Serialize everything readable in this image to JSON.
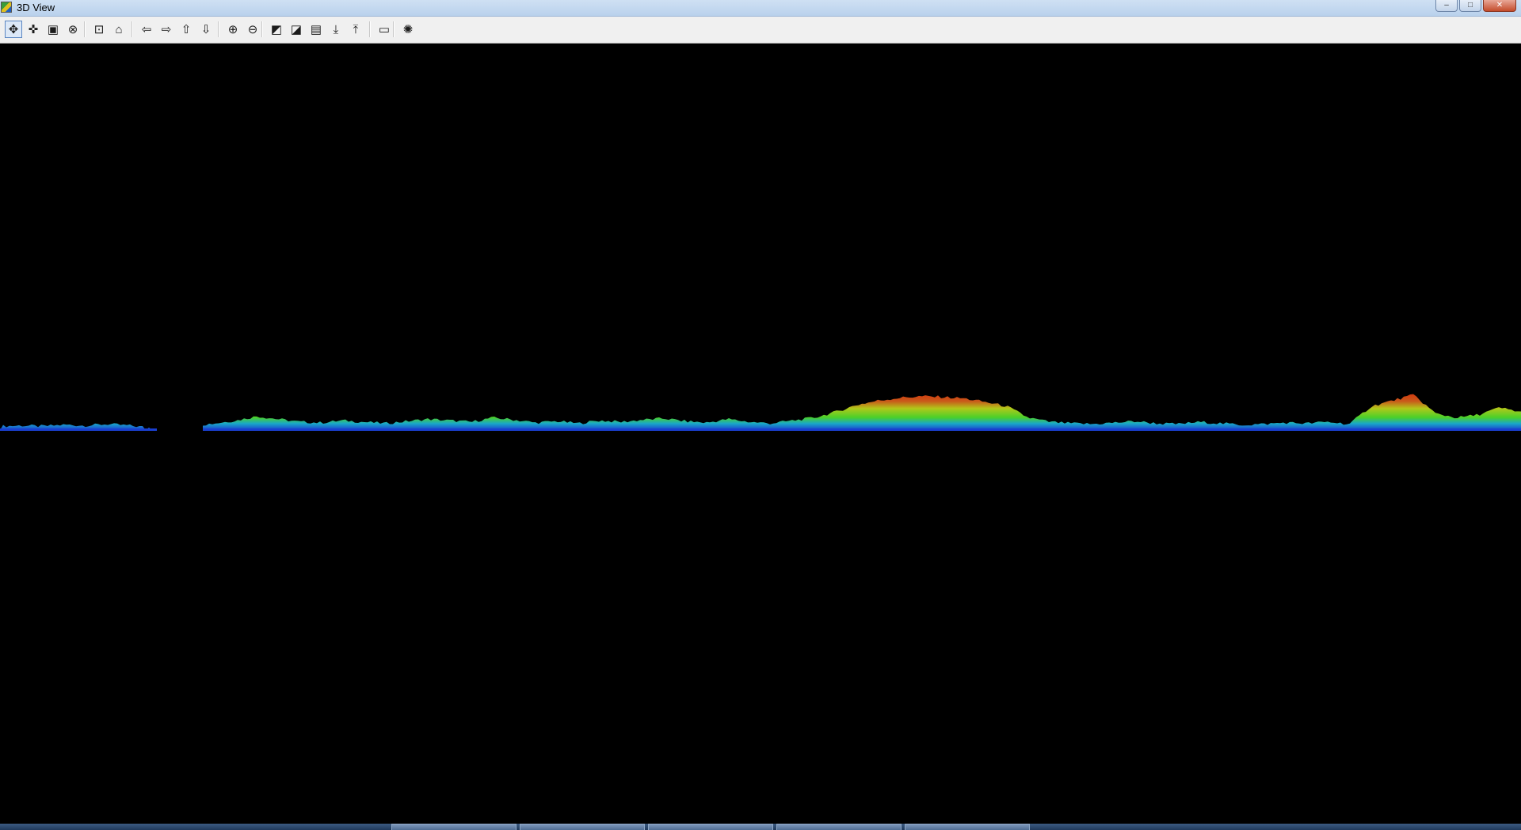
{
  "window": {
    "title": "3D View",
    "controls": {
      "minimize": "–",
      "maximize": "□",
      "close": "✕"
    }
  },
  "toolbar": {
    "buttons": [
      {
        "id": "rotate",
        "icon": "rotate-arrows-icon",
        "glyph": "✥",
        "active": true
      },
      {
        "id": "pan",
        "icon": "pan-arrows-icon",
        "glyph": "✜",
        "active": false
      },
      {
        "id": "zoom-window",
        "icon": "zoom-window-icon",
        "glyph": "▣",
        "active": false
      },
      {
        "id": "find",
        "icon": "binoculars-icon",
        "glyph": "⊗",
        "active": false
      },
      {
        "id": "fit-all",
        "icon": "fit-view-icon",
        "glyph": "⊡",
        "active": false
      },
      {
        "id": "home",
        "icon": "home-icon",
        "glyph": "⌂",
        "active": false
      },
      {
        "id": "left",
        "icon": "arrow-left-icon",
        "glyph": "⇦",
        "active": false
      },
      {
        "id": "right",
        "icon": "arrow-right-icon",
        "glyph": "⇨",
        "active": false
      },
      {
        "id": "up",
        "icon": "arrow-up-icon",
        "glyph": "⇧",
        "active": false
      },
      {
        "id": "down",
        "icon": "arrow-down-icon",
        "glyph": "⇩",
        "active": false
      },
      {
        "id": "zoom-in",
        "icon": "zoom-in-icon",
        "glyph": "⊕",
        "active": false
      },
      {
        "id": "zoom-out",
        "icon": "zoom-out-icon",
        "glyph": "⊖",
        "active": false
      },
      {
        "id": "surface",
        "icon": "surface-chart-icon",
        "glyph": "◩",
        "active": false
      },
      {
        "id": "surface-edit",
        "icon": "surface-edit-icon",
        "glyph": "◪",
        "active": false
      },
      {
        "id": "layers",
        "icon": "layers-icon",
        "glyph": "▤",
        "active": false
      },
      {
        "id": "import",
        "icon": "import-down-icon",
        "glyph": "⤓",
        "active": false
      },
      {
        "id": "export",
        "icon": "export-up-icon",
        "glyph": "⤒",
        "active": false
      },
      {
        "id": "save",
        "icon": "floppy-disk-icon",
        "glyph": "▭",
        "active": false
      },
      {
        "id": "settings",
        "icon": "light-settings-icon",
        "glyph": "✺",
        "active": false
      }
    ]
  },
  "colors": {
    "background": "#000000",
    "terrain_low": "#1a3fd0",
    "terrain_mid": "#4bd02a",
    "terrain_high": "#c95a1a",
    "terrain_peak": "#d03a10"
  },
  "view": {
    "scene": "terrain-cross-section",
    "terrain_profile": [
      0.02,
      0.03,
      0.02,
      0.04,
      0.03,
      0.05,
      0.03,
      0.0,
      0.0,
      0.03,
      0.06,
      0.1,
      0.16,
      0.12,
      0.08,
      0.07,
      0.1,
      0.08,
      0.06,
      0.09,
      0.12,
      0.1,
      0.08,
      0.14,
      0.11,
      0.07,
      0.09,
      0.06,
      0.1,
      0.08,
      0.11,
      0.13,
      0.09,
      0.07,
      0.12,
      0.08,
      0.06,
      0.1,
      0.14,
      0.22,
      0.32,
      0.38,
      0.42,
      0.44,
      0.43,
      0.41,
      0.36,
      0.3,
      0.14,
      0.08,
      0.06,
      0.05,
      0.07,
      0.09,
      0.06,
      0.05,
      0.08,
      0.06,
      0.04,
      0.05,
      0.07,
      0.06,
      0.08,
      0.05,
      0.3,
      0.38,
      0.46,
      0.2,
      0.14,
      0.18,
      0.28,
      0.22
    ]
  }
}
